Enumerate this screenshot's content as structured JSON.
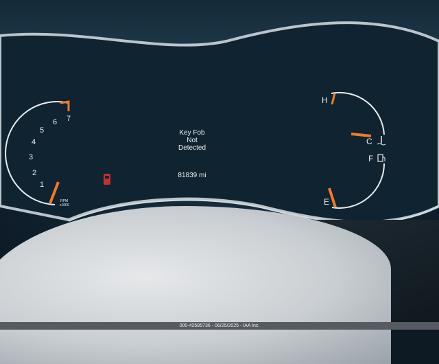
{
  "cluster": {
    "message": {
      "line1": "Key Fob",
      "line2": "Not",
      "line3": "Detected"
    },
    "odometer": "81839 mi",
    "tachometer": {
      "numbers": [
        "1",
        "2",
        "3",
        "4",
        "5",
        "6",
        "7"
      ],
      "unit_line1": "RPM",
      "unit_line2": "x1000"
    },
    "temperature": {
      "hot_label": "H",
      "cold_label": "C"
    },
    "fuel": {
      "full_label": "F",
      "empty_label": "E"
    }
  },
  "caption": "000-42585736 - 06/25/2025 - IAA Inc.",
  "icons": [
    "door-ajar-icon",
    "coolant-temp-icon",
    "fuel-pump-icon"
  ],
  "colors": {
    "needle": "#f07a28",
    "redline": "#f07a28",
    "display": "#0f2330",
    "text": "#eef2f5"
  }
}
